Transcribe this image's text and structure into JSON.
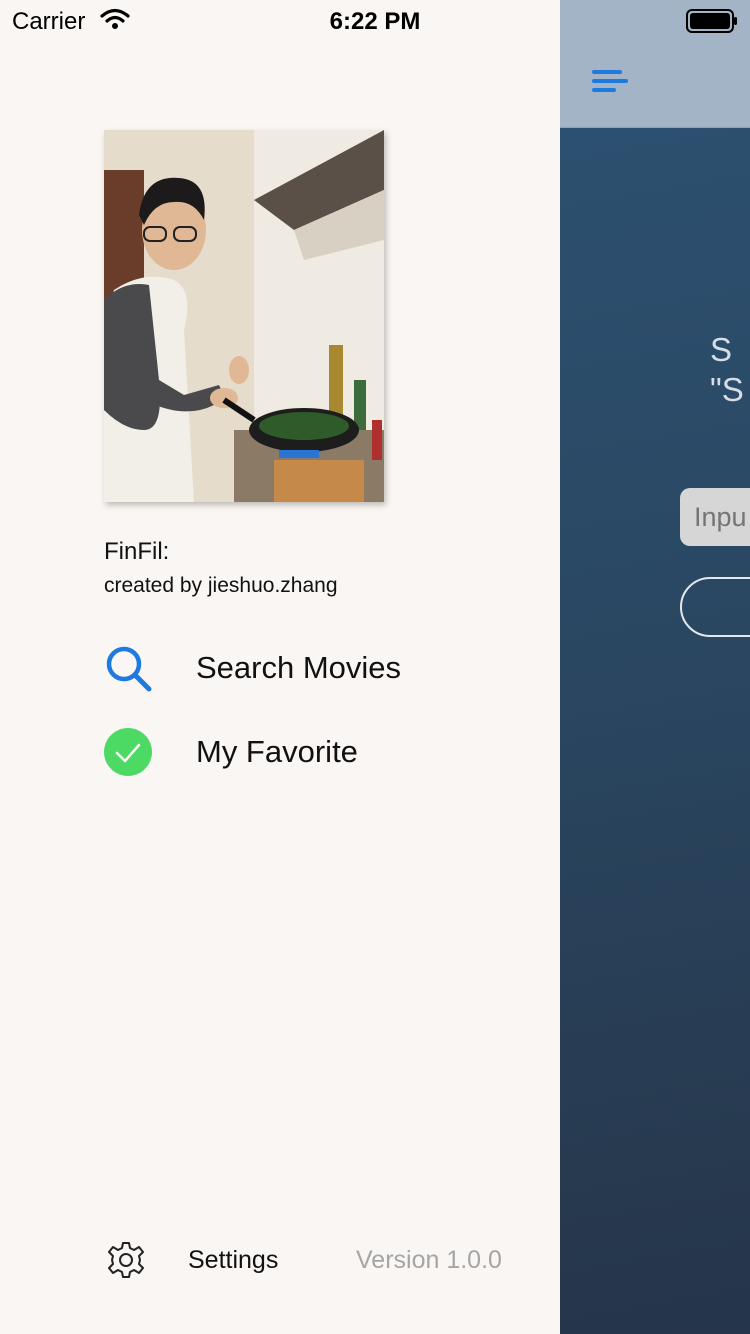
{
  "status_bar": {
    "carrier": "Carrier",
    "time": "6:22 PM"
  },
  "main": {
    "hint_text": "S\n\"S",
    "search_placeholder": "Inpu"
  },
  "drawer": {
    "app_name": "FinFil:",
    "credit": "created by jieshuo.zhang",
    "menu": [
      {
        "label": "Search Movies",
        "icon": "search-icon",
        "color": "#1f7ae0"
      },
      {
        "label": "My Favorite",
        "icon": "checkmark-circle-icon",
        "color": "#4cd964"
      }
    ],
    "settings_label": "Settings",
    "version": "Version 1.0.0"
  },
  "colors": {
    "accent": "#1f7ae0",
    "drawer_bg": "#faf6f3",
    "main_bg": "#2a4863",
    "nav_bg": "#a3b4c6"
  }
}
